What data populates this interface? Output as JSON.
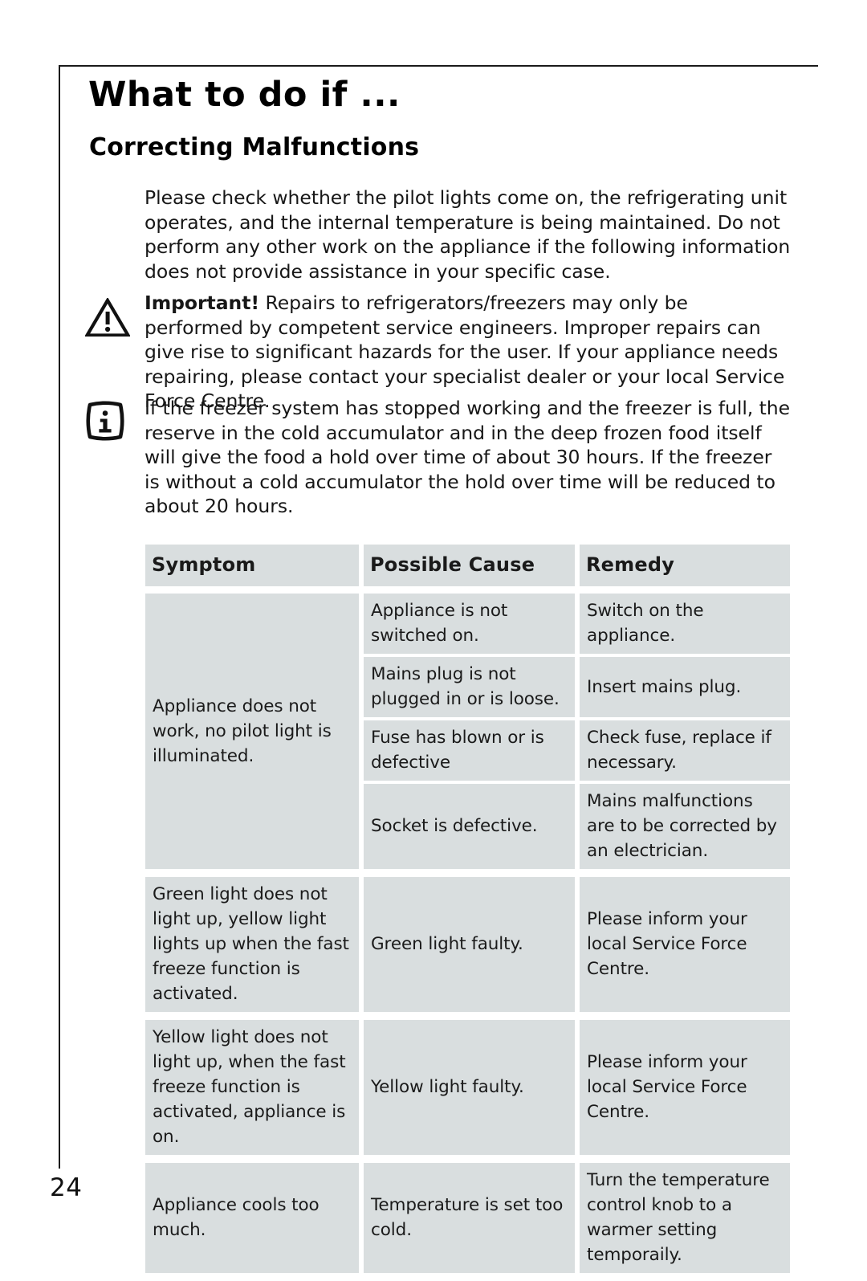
{
  "document": {
    "page_title": "What to do if ...",
    "section_title": "Correcting Malfunctions",
    "page_number": "24"
  },
  "paragraphs": {
    "intro": "Please check whether the pilot lights come on, the refrigerating unit operates, and the internal temperature is being maintained. Do not perform any other work on the appliance if the following information does not provide assistance in your specific case.",
    "important_lead": "Important!",
    "important_body": " Repairs to refrigerators/freezers may only be performed by competent service engineers. Improper repairs can give rise to significant hazards for the user. If your appliance needs repairing, please contact your specialist dealer or your local Service Force Centre.",
    "note": "If the freezer system has stopped working and the freezer is full, the reserve in the cold accumulator and in the deep frozen food itself will give the food a hold over time of about 30 hours. If the freezer is without a cold accumulator the hold over time will be reduced to about 20 hours."
  },
  "icons": {
    "warning": "warning-triangle-icon",
    "info": "information-icon"
  },
  "table": {
    "headers": {
      "symptom": "Symptom",
      "cause": "Possible Cause",
      "remedy": "Remedy"
    },
    "groups": [
      {
        "symptom": "Appliance does not work, no pilot light is illuminated.",
        "rows": [
          {
            "cause": "Appliance is not switched on.",
            "remedy": "Switch on the appliance."
          },
          {
            "cause": "Mains plug is not plugged in or is loose.",
            "remedy": "Insert mains plug."
          },
          {
            "cause": "Fuse has blown or is defective",
            "remedy": "Check fuse, replace if necessary."
          },
          {
            "cause": "Socket is defective.",
            "remedy": "Mains malfunctions are to be corrected by an electrician."
          }
        ]
      },
      {
        "symptom": "Green light does not light up, yellow light lights up when the fast freeze function is activated.",
        "rows": [
          {
            "cause": "Green light faulty.",
            "remedy": "Please inform your local Service Force Centre."
          }
        ]
      },
      {
        "symptom": "Yellow light does not light up, when the fast freeze function is activated, appliance is on.",
        "rows": [
          {
            "cause": "Yellow light faulty.",
            "remedy": "Please inform your local Service Force Centre."
          }
        ]
      },
      {
        "symptom": "Appliance cools too much.",
        "rows": [
          {
            "cause": "Temperature is set too cold.",
            "remedy": "Turn the temperature control knob to a warmer setting temporaily."
          }
        ]
      }
    ]
  },
  "colors": {
    "cell_fill": "#d9dedf",
    "rule": "#1a1a1a",
    "text": "#1a1a1a"
  }
}
